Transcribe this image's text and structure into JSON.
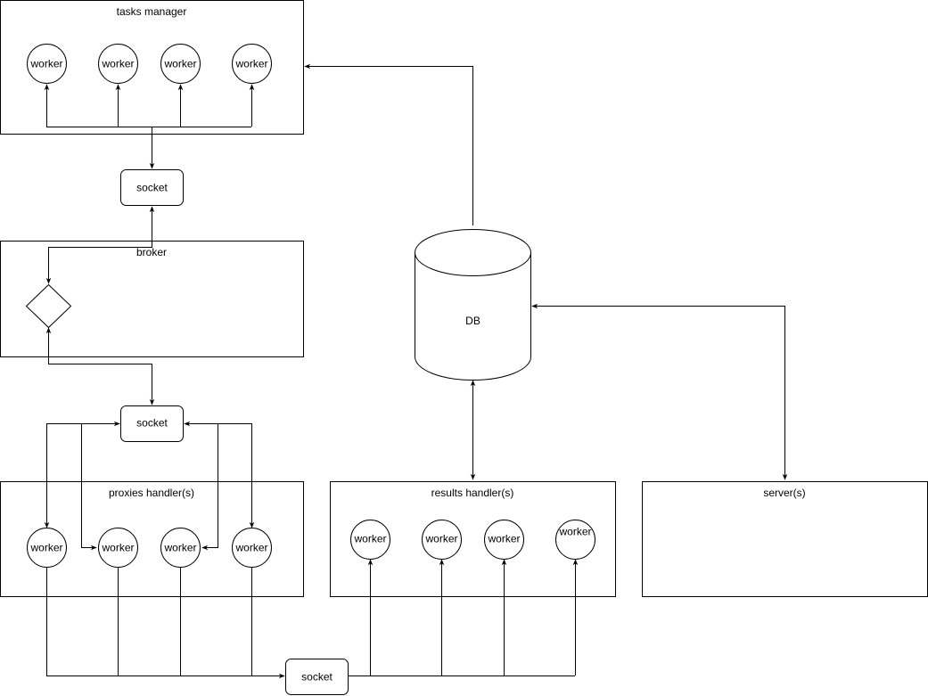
{
  "containers": {
    "tasks_manager": "tasks manager",
    "broker": "broker",
    "proxies_handler": "proxies handler(s)",
    "results_handler": "results handler(s)",
    "server": "server(s)"
  },
  "sockets": {
    "top": "socket",
    "middle": "socket",
    "bottom": "socket"
  },
  "database": {
    "label": "DB"
  },
  "workers": {
    "tasks_manager": [
      "worker",
      "worker",
      "worker",
      "worker"
    ],
    "proxies_handler": [
      "worker",
      "worker",
      "worker",
      "worker"
    ],
    "results_handler": [
      "worker",
      "worker",
      "worker",
      "worker"
    ]
  }
}
